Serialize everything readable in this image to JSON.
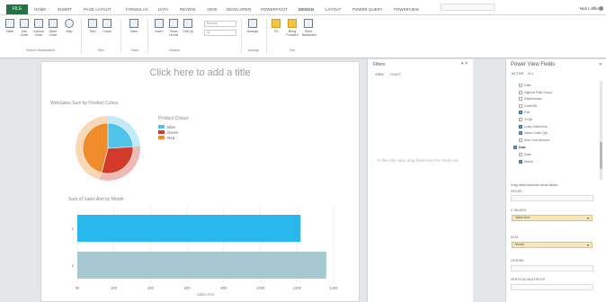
{
  "tabs": {
    "file": "FILE",
    "items": [
      "HOME",
      "INSERT",
      "PAGE LAYOUT",
      "FORMULAS",
      "DATA",
      "REVIEW",
      "VIEW",
      "DEVELOPER",
      "POWERPIVOT",
      "DESIGN",
      "LAYOUT",
      "POWER QUERY",
      "POWERVIEW"
    ],
    "active": "DESIGN",
    "user": "Nick Loffler"
  },
  "ribbon": {
    "buttons": [
      "Table",
      "Bar Chart",
      "Column Chart",
      "Other Chart",
      "Map",
      "Tiles",
      "Cards",
      "Slicer",
      "Insert",
      "Show Levels",
      "Drill Up",
      "Arrange",
      "Fit",
      "Bring Forward",
      "Send Backward"
    ],
    "groups": [
      "Switch Visualization",
      "Tiles",
      "Slicer",
      "Options",
      "Arrange",
      "Text"
    ],
    "combo": "Normal",
    "combo2": "11"
  },
  "sheet": {
    "title": "Click here to add a title"
  },
  "pie_title": "WebSales Sum by Product Colour",
  "bar_title": "Sum of Sales Amt by Month",
  "filters": {
    "title": "Filters",
    "tabs": [
      "VIEW",
      "CHART"
    ],
    "hint": "To filter the view, drag fields from the Field List"
  },
  "fields": {
    "title": "Power View Fields",
    "tabs": [
      "ACTIVE",
      "ALL"
    ],
    "items": [
      {
        "label": "Date",
        "checked": false
      },
      {
        "label": "Highest Risk Group",
        "checked": false
      },
      {
        "label": "RiskNumber",
        "checked": false
      },
      {
        "label": "Outlet/ID",
        "checked": false
      },
      {
        "label": "Flat",
        "checked": true
      },
      {
        "label": "Yr/Qtr",
        "checked": false
      },
      {
        "label": "Unitq Sales Amt",
        "checked": true
      },
      {
        "label": "Sales Order Qty",
        "checked": true
      },
      {
        "label": "Sum Line Amount",
        "checked": false
      }
    ],
    "table": "Date",
    "sub_items": [
      {
        "label": "Date",
        "checked": false
      },
      {
        "label": "Month",
        "checked": true
      }
    ],
    "drag_hint": "Drag fields between areas below:",
    "sections": [
      "FIELDS",
      "Σ VALUES",
      "AXIS",
      "LEGEND",
      "VERTICAL MULTIPLES"
    ],
    "values_pill": "Sales Amt",
    "axis_pill": "Month"
  },
  "chart_data": [
    {
      "type": "pie",
      "title": "WebSales Sum by Product Colour",
      "legend_title": "Product Colour",
      "legend": "right",
      "categories": [
        "Blue",
        "Green",
        "Red"
      ],
      "values": [
        24,
        30,
        46
      ],
      "colors": {
        "Blue": "#4fc3ea",
        "Green": "#d23a2a",
        "Red": "#f08c2c"
      }
    },
    {
      "type": "bar",
      "title": "Sum of Sales Amt by Month",
      "xlabel": "Sales Amt",
      "categories": [
        "1",
        "2"
      ],
      "series": [
        {
          "values": [
            1220,
            1360
          ]
        }
      ],
      "ticks": [
        "0K",
        "200",
        "400",
        "600",
        "800",
        "1000",
        "1200",
        "1400"
      ],
      "xlim": [
        0,
        1400
      ],
      "colors": [
        "#29b8ee",
        "#a6c8d0"
      ],
      "grid": true
    }
  ]
}
